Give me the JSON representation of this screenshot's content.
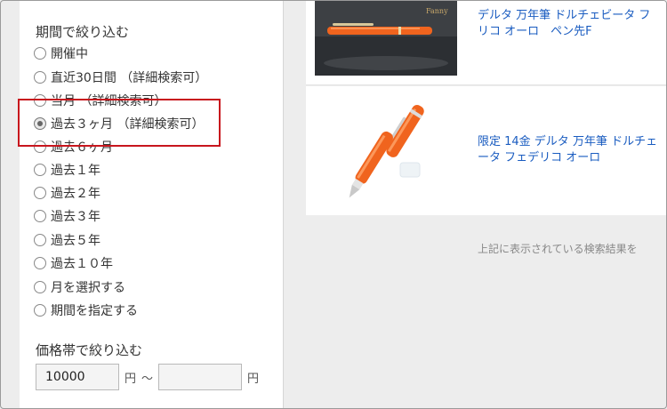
{
  "filters": {
    "period_title": "期間で絞り込む",
    "period_options": [
      {
        "label": "開催中",
        "checked": false
      },
      {
        "label": "直近30日間 （詳細検索可）",
        "checked": false
      },
      {
        "label": "当月 （詳細検索可）",
        "checked": false
      },
      {
        "label": "過去３ヶ月 （詳細検索可）",
        "checked": true
      },
      {
        "label": "過去６ヶ月",
        "checked": false
      },
      {
        "label": "過去１年",
        "checked": false
      },
      {
        "label": "過去２年",
        "checked": false
      },
      {
        "label": "過去３年",
        "checked": false
      },
      {
        "label": "過去５年",
        "checked": false
      },
      {
        "label": "過去１０年",
        "checked": false
      },
      {
        "label": "月を選択する",
        "checked": false
      },
      {
        "label": "期間を指定する",
        "checked": false
      }
    ],
    "price_title": "価格帯で絞り込む",
    "price_min_value": "10000",
    "price_max_value": "",
    "currency_unit": "円",
    "range_separator": "〜"
  },
  "results": [
    {
      "title_line1": "デルタ 万年筆 ドルチェビータ フ",
      "title_line2": "リコ オーロ　ペン先F",
      "image": "orange-fountain-pen-capped"
    },
    {
      "title_line1": "限定 14金 デルタ 万年筆 ドルチェ",
      "title_line2": "ータ フェデリコ オーロ",
      "image": "orange-fountain-pen-open"
    }
  ],
  "footer_note": "上記に表示されている検索結果を",
  "colors": {
    "link": "#1a5cc0",
    "highlight": "#c8161d",
    "pen_orange": "#f0641e"
  }
}
